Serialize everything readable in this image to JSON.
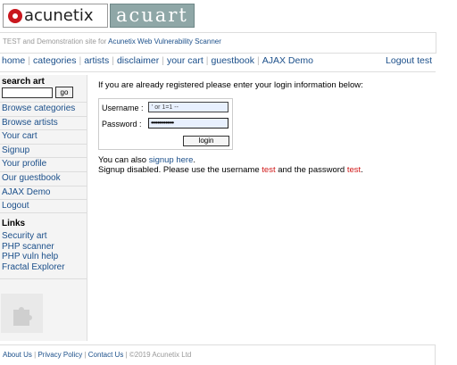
{
  "logo": {
    "left_text": "acunetix",
    "right_text": "acuart"
  },
  "tagline": {
    "prefix": "TEST and Demonstration site for ",
    "link": "Acunetix Web Vulnerability Scanner"
  },
  "menu": {
    "items": [
      "home",
      "categories",
      "artists",
      "disclaimer",
      "your cart",
      "guestbook",
      "AJAX Demo"
    ],
    "separator": "|",
    "logout": "Logout test"
  },
  "sidebar": {
    "search_title": "search art",
    "search_value": "",
    "go_label": "go",
    "items": [
      "Browse categories",
      "Browse artists",
      "Your cart",
      "Signup",
      "Your profile",
      "Our guestbook",
      "AJAX Demo",
      "Logout"
    ],
    "links_title": "Links",
    "links": [
      "Security art",
      "PHP scanner",
      "PHP vuln help",
      "Fractal Explorer"
    ]
  },
  "login": {
    "intro": "If you are already registered please enter your login information below:",
    "username_label": "Username :",
    "username_value": "' or 1=1 --",
    "password_label": "Password :",
    "password_value": "••••••••••••••",
    "button_label": "login",
    "signup_prefix": "You can also ",
    "signup_link": "signup here",
    "signup_suffix": ".",
    "disabled_prefix": "Signup disabled. Please use the username ",
    "disabled_user": "test",
    "disabled_mid": " and the password ",
    "disabled_pass": "test",
    "disabled_suffix": "."
  },
  "footer": {
    "about": "About Us",
    "sep": " | ",
    "privacy": "Privacy Policy",
    "contact": "Contact Us",
    "copyright": "©2019 Acunetix Ltd"
  },
  "colors": {
    "link": "#1b4f8a",
    "accent_red": "#d01818",
    "logo_red": "#c9171e",
    "logo_slate": "#8fa7a7"
  },
  "icons": {
    "logo": "acunetix-logo-icon",
    "plugin": "puzzle-plugin-icon"
  }
}
